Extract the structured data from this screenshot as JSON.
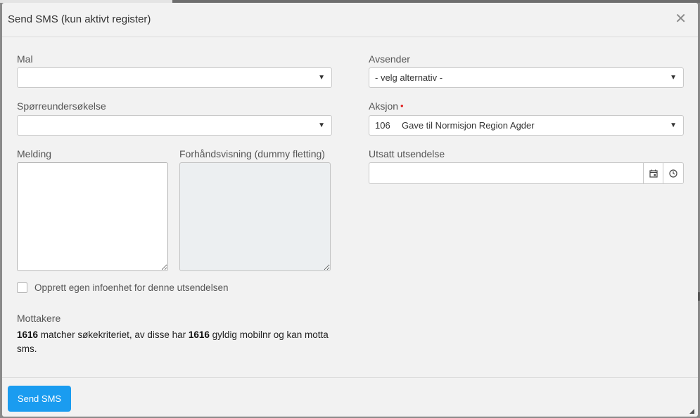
{
  "dialog": {
    "title": "Send SMS (kun aktivt register)"
  },
  "fields": {
    "mal": {
      "label": "Mal",
      "value": ""
    },
    "sporreundersokelse": {
      "label": "Spørreundersøkelse",
      "value": ""
    },
    "melding": {
      "label": "Melding",
      "value": ""
    },
    "forhandsvisning": {
      "label": "Forhåndsvisning (dummy fletting)",
      "value": ""
    },
    "avsender": {
      "label": "Avsender",
      "value": "- velg alternativ -"
    },
    "aksjon": {
      "label": "Aksjon",
      "required_mark": "•",
      "code": "106",
      "name": "Gave til Normisjon Region Agder"
    },
    "utsatt": {
      "label": "Utsatt utsendelse",
      "value": ""
    }
  },
  "checkbox": {
    "label": "Opprett egen infoenhet for denne utsendelsen",
    "checked": false
  },
  "mottakere": {
    "label": "Mottakere",
    "match_count": "1616",
    "text_1": " matcher søkekriteriet, av disse har ",
    "valid_count": "1616",
    "text_2": " gyldig mobilnr og kan motta sms."
  },
  "footer": {
    "send_label": "Send SMS"
  },
  "icons": {
    "close": "close-icon",
    "caret": "chevron-down-icon",
    "calendar": "calendar-icon",
    "clock": "clock-icon"
  },
  "colors": {
    "primary": "#1a9cf0",
    "required": "#e02020",
    "background": "#f2f2f2"
  }
}
